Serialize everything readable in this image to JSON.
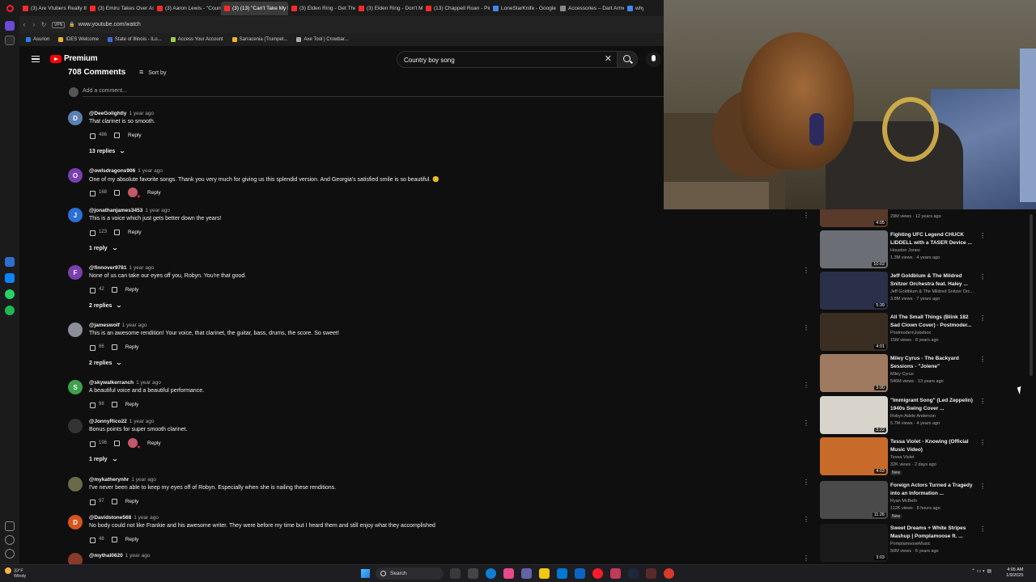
{
  "browser": {
    "tabs": [
      {
        "label": "(3) Are Vtubers Really the",
        "active": false,
        "color": "#ff2a2a"
      },
      {
        "label": "(3) Emiru Takes Over Asm",
        "active": false,
        "color": "#ff2a2a"
      },
      {
        "label": "(3) Aaron Lewis - \"Count",
        "active": false,
        "color": "#ff2a2a"
      },
      {
        "label": "(3) (13) \"Can't Take My E",
        "active": true,
        "color": "#ff2a2a"
      },
      {
        "label": "(3) Elden Ring - Get Thes",
        "active": false,
        "color": "#ff2a2a"
      },
      {
        "label": "(3) Elden Ring - Don't Mis",
        "active": false,
        "color": "#ff2a2a"
      },
      {
        "label": "(13) Chappell Roan - Pink",
        "active": false,
        "color": "#ff2a2a"
      },
      {
        "label": "LoneStarKnife - Google S",
        "active": false,
        "color": "#4285f4"
      },
      {
        "label": "Accessories – Dart Armou",
        "active": false,
        "color": "#888888"
      },
      {
        "label": "why",
        "active": false,
        "color": "#4285f4"
      }
    ],
    "vpn_label": "VPN",
    "url": "www.youtube.com/watch",
    "bookmarks": [
      {
        "label": "Asurion",
        "color": "#2b7de9"
      },
      {
        "label": "IDES Welcome",
        "color": "#e9b52b"
      },
      {
        "label": "State of Illinois - ILo...",
        "color": "#3a6fd8"
      },
      {
        "label": "Access Your Account",
        "color": "#9acb4a"
      },
      {
        "label": "Sarracenia (Trumpet...",
        "color": "#e9b52b"
      },
      {
        "label": "Axe Tool | Crowbar...",
        "color": "#aaaaaa"
      }
    ]
  },
  "youtube": {
    "brand": "Premium",
    "search_value": "Country boy song",
    "comments_heading": "708 Comments",
    "sort_label": "Sort by",
    "add_comment_placeholder": "Add a comment...",
    "reply_label": "Reply",
    "comments": [
      {
        "user": "@DeeGolightly",
        "time": "1 year ago",
        "text": "That clarinet is so smooth.",
        "likes": "486",
        "replies": "13 replies",
        "avatar": "D",
        "avatar_color": "#5b7fb0",
        "hearted": false
      },
      {
        "user": "@owlsdragons906",
        "time": "1 year ago",
        "text": "One of my absolute favorite songs. Thank you very much for giving us this splendid version. And Georgia's satisfied smile is so beautiful. 😊",
        "likes": "168",
        "replies": "",
        "avatar": "O",
        "avatar_color": "#7b3fb0",
        "hearted": true
      },
      {
        "user": "@jonathanjames3453",
        "time": "1 year ago",
        "text": "This is a voice which just gets better down the years!",
        "likes": "123",
        "replies": "1 reply",
        "avatar": "J",
        "avatar_color": "#2a6fd6",
        "hearted": false
      },
      {
        "user": "@finnover9781",
        "time": "1 year ago",
        "text": "None of us can take our eyes off you, Robyn. You're that good.",
        "likes": "42",
        "replies": "2 replies",
        "avatar": "F",
        "avatar_color": "#7b3fb0",
        "hearted": false
      },
      {
        "user": "@jameswolf",
        "time": "1 year ago",
        "text": "This is an awesome rendition!  Your voice, that clarinet, the guitar, bass, drums, the score.  So sweet!",
        "likes": "86",
        "replies": "2 replies",
        "avatar": "",
        "avatar_color": "#8a8f9a",
        "hearted": false
      },
      {
        "user": "@skywalkerranch",
        "time": "1 year ago",
        "text": "A beautiful voice and a beautiful performance.",
        "likes": "98",
        "replies": "",
        "avatar": "S",
        "avatar_color": "#3fa04a",
        "hearted": false
      },
      {
        "user": "@JonnyRico22",
        "time": "1 year ago",
        "text": "Bonus points for super smooth clarinet.",
        "likes": "196",
        "replies": "1 reply",
        "avatar": "",
        "avatar_color": "#333333",
        "hearted": true
      },
      {
        "user": "@mykatherynhr",
        "time": "1 year ago",
        "text": "I've never been able to keep my eyes off of Robyn. Especially when she is nailing these renditions.",
        "likes": "97",
        "replies": "",
        "avatar": "",
        "avatar_color": "#6a6a4a",
        "hearted": false
      },
      {
        "user": "@Davidstone568",
        "time": "1 year ago",
        "text": "No body could not like Frankie and his awesome writer. They were before my time but I heard them and still enjoy what they accomplished",
        "likes": "48",
        "replies": "",
        "avatar": "D",
        "avatar_color": "#d4551e",
        "hearted": false
      },
      {
        "user": "@mythal0620",
        "time": "1 year ago",
        "text": "",
        "likes": "",
        "replies": "",
        "avatar": "",
        "avatar_color": "#8a3a2a",
        "hearted": false
      }
    ],
    "recommendations": [
      {
        "title": "",
        "channel": "",
        "views": "29M views · 12 years ago",
        "duration": "4:05",
        "thumb": "#5a3a2a",
        "new": ""
      },
      {
        "title": "Fighting UFC Legend CHUCK LIDDELL with a TASER Device ...",
        "channel": "Houston Jones",
        "views": "1.3M views · 4 years ago",
        "duration": "10:02",
        "thumb": "#6b6f75",
        "new": ""
      },
      {
        "title": "Jeff Goldblum & The Mildred Snitzer Orchestra feat. Haley ...",
        "channel": "Jeff Goldblum & The Mildred Snitzer Orc...",
        "views": "3.8M views · 7 years ago",
        "duration": "5:39",
        "thumb": "#2a2f4a",
        "new": ""
      },
      {
        "title": "All The Small Things (Blink 182 Sad Clown Cover) - Postmoder...",
        "channel": "PostmodernJukebox",
        "views": "15M views · 8 years ago",
        "duration": "4:01",
        "thumb": "#3a2e22",
        "new": ""
      },
      {
        "title": "Miley Cyrus - The Backyard Sessions - \"Jolene\"",
        "channel": "Miley Cyrus",
        "views": "546M views · 13 years ago",
        "duration": "3:00",
        "thumb": "#a07a60",
        "new": ""
      },
      {
        "title": "\"Immigrant Song\" (Led Zeppelin) 1940s Swing Cover ...",
        "channel": "Robyn Adele Anderson",
        "views": "5.7M views · 4 years ago",
        "duration": "3:22",
        "thumb": "#d8d4cc",
        "new": ""
      },
      {
        "title": "Tessa Violet - Knowing (Official Music Video)",
        "channel": "Tessa Violet",
        "views": "32K views · 2 days ago",
        "duration": "4:03",
        "thumb": "#c86a2a",
        "new": "New"
      },
      {
        "title": "Foreign Actors Turned a Tragedy into an Information ...",
        "channel": "Ryan McBeth",
        "views": "112K views · 8 hours ago",
        "duration": "11:26",
        "thumb": "#4a4a4a",
        "new": "New"
      },
      {
        "title": "Sweet Dreams + White Stripes Mashup | Pomplamoose ft. ...",
        "channel": "PomplamooseMusic",
        "views": "50M views · 6 years ago",
        "duration": "3:03",
        "thumb": "#1a1a1a",
        "new": ""
      }
    ]
  },
  "taskbar": {
    "weather_temp": "33°F",
    "weather_desc": "Windy",
    "search_label": "Search",
    "time": "4:05 AM",
    "date": "1/9/2025"
  }
}
